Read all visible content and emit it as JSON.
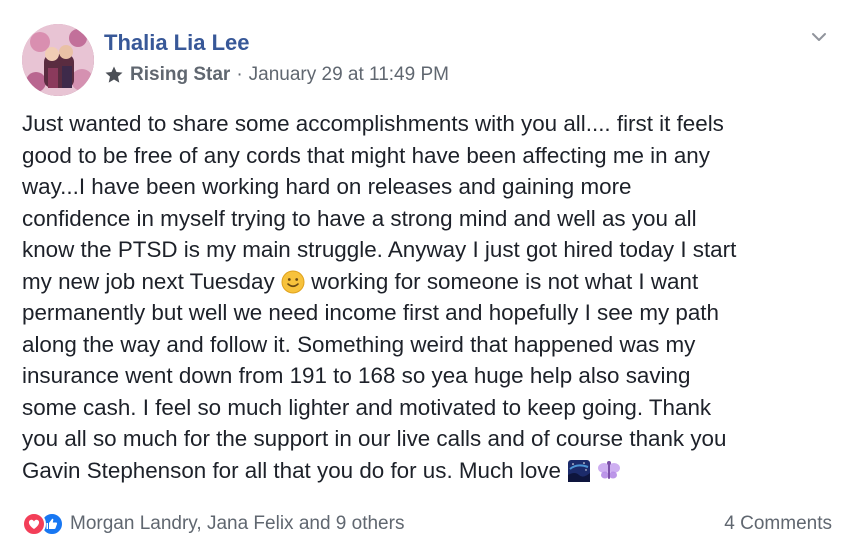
{
  "post": {
    "author": "Thalia Lia Lee",
    "badge": "Rising Star",
    "separator": "·",
    "timestamp": "January 29 at 11:49 PM",
    "text_lines": [
      "Just wanted to share some accomplishments with you all.... first it feels",
      "good to be free of any cords that might have been affecting me in any",
      "way...I have been working hard on releases and gaining more",
      "confidence in myself trying to have a strong mind and well as you all",
      "know the PTSD is my main struggle. Anyway I just got hired today I start",
      "my new job next Tuesday",
      "working for someone is not what I want",
      "permanently but well we need income first and hopefully I see my path",
      "along the way and follow it. Something weird that happened was my",
      "insurance went down from 191 to 168 so yea huge help also saving",
      "some cash. I feel so much lighter and motivated to keep going. Thank",
      "you all so much for the support in our live calls and of course thank you",
      "Gavin Stephenson for all that you do for us. Much love"
    ]
  },
  "reactions": {
    "names": "Morgan Landry, Jana Felix and 9 others",
    "comments": "4 Comments"
  },
  "colors": {
    "author": "#385898",
    "meta": "#606770",
    "love": "#f33e58",
    "like": "#1877f2"
  }
}
